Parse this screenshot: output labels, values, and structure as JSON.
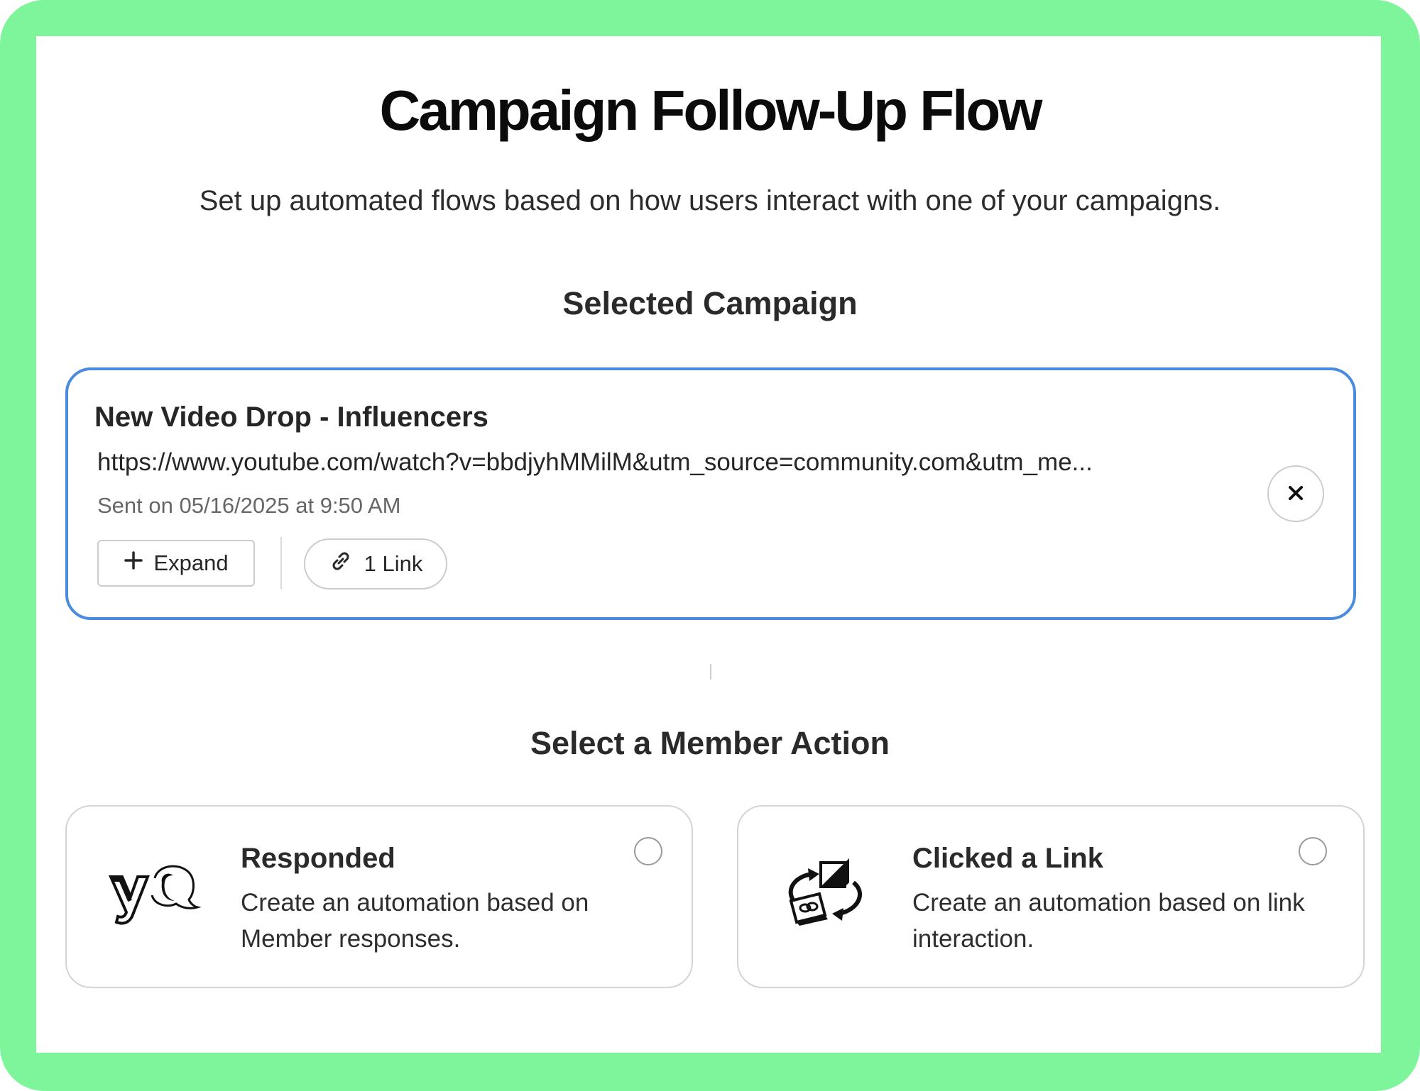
{
  "header": {
    "title": "Campaign Follow-Up Flow",
    "subtitle": "Set up automated flows based on how users interact with one of your campaigns."
  },
  "selected_campaign": {
    "heading": "Selected Campaign",
    "name": "New Video Drop - Influencers",
    "url": "https://www.youtube.com/watch?v=bbdjyhMMilM&utm_source=community.com&utm_me...",
    "sent": "Sent on 05/16/2025 at 9:50 AM",
    "expand_label": "Expand",
    "links_label": "1 Link",
    "icons": {
      "expand": "plus-icon",
      "links": "link-icon",
      "close": "close-icon"
    }
  },
  "member_action": {
    "heading": "Select a Member Action",
    "options": [
      {
        "title": "Responded",
        "description": "Create an automation based on Member responses.",
        "icon": "speech-bubble-icon",
        "selected": false
      },
      {
        "title": "Clicked a Link",
        "description": "Create an automation based on link interaction.",
        "icon": "link-cycle-icon",
        "selected": false
      }
    ]
  },
  "colors": {
    "frame": "#7ef59a",
    "accent_border": "#4a8be0",
    "text_primary": "#0b0b0b",
    "text_muted": "#666666"
  }
}
